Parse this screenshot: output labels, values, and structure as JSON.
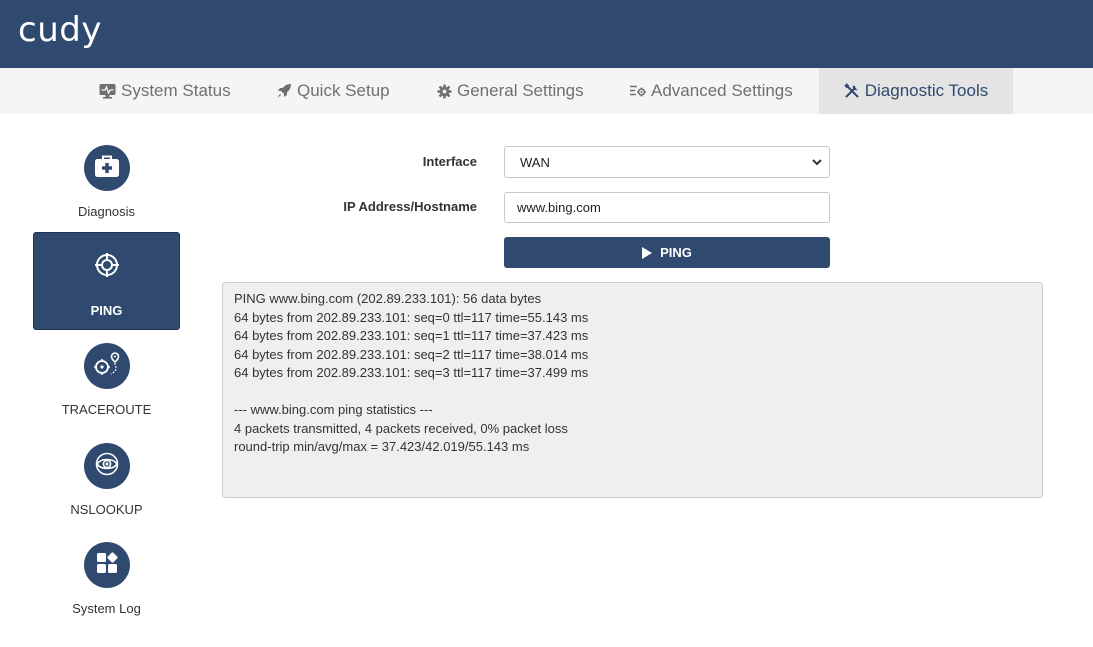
{
  "brand": {
    "logo_text": "cudy"
  },
  "nav": {
    "tabs": [
      {
        "label": "System Status",
        "icon": "monitor-icon"
      },
      {
        "label": "Quick Setup",
        "icon": "rocket-icon"
      },
      {
        "label": "General Settings",
        "icon": "gear-icon"
      },
      {
        "label": "Advanced Settings",
        "icon": "advanced-settings-icon"
      },
      {
        "label": "Diagnostic Tools",
        "icon": "tools-icon",
        "active": true
      }
    ]
  },
  "sidebar": {
    "items": [
      {
        "label": "Diagnosis",
        "icon": "medkit-icon"
      },
      {
        "label": "PING",
        "icon": "crosshair-icon",
        "active": true
      },
      {
        "label": "TRACEROUTE",
        "icon": "route-icon"
      },
      {
        "label": "NSLOOKUP",
        "icon": "eye-icon"
      },
      {
        "label": "System Log",
        "icon": "grid-icon"
      }
    ]
  },
  "form": {
    "interface_label": "Interface",
    "interface_value": "WAN",
    "host_label": "IP Address/Hostname",
    "host_value": "www.bing.com",
    "ping_button": "PING"
  },
  "output": {
    "lines": [
      "PING www.bing.com (202.89.233.101): 56 data bytes",
      "64 bytes from 202.89.233.101: seq=0 ttl=117 time=55.143 ms",
      "64 bytes from 202.89.233.101: seq=1 ttl=117 time=37.423 ms",
      "64 bytes from 202.89.233.101: seq=2 ttl=117 time=38.014 ms",
      "64 bytes from 202.89.233.101: seq=3 ttl=117 time=37.499 ms",
      "",
      "--- www.bing.com ping statistics ---",
      "4 packets transmitted, 4 packets received, 0% packet loss",
      "round-trip min/avg/max = 37.423/42.019/55.143 ms"
    ]
  },
  "colors": {
    "brand": "#2f4a6e",
    "nav_bg": "#f5f5f5",
    "output_bg": "#efefef"
  }
}
